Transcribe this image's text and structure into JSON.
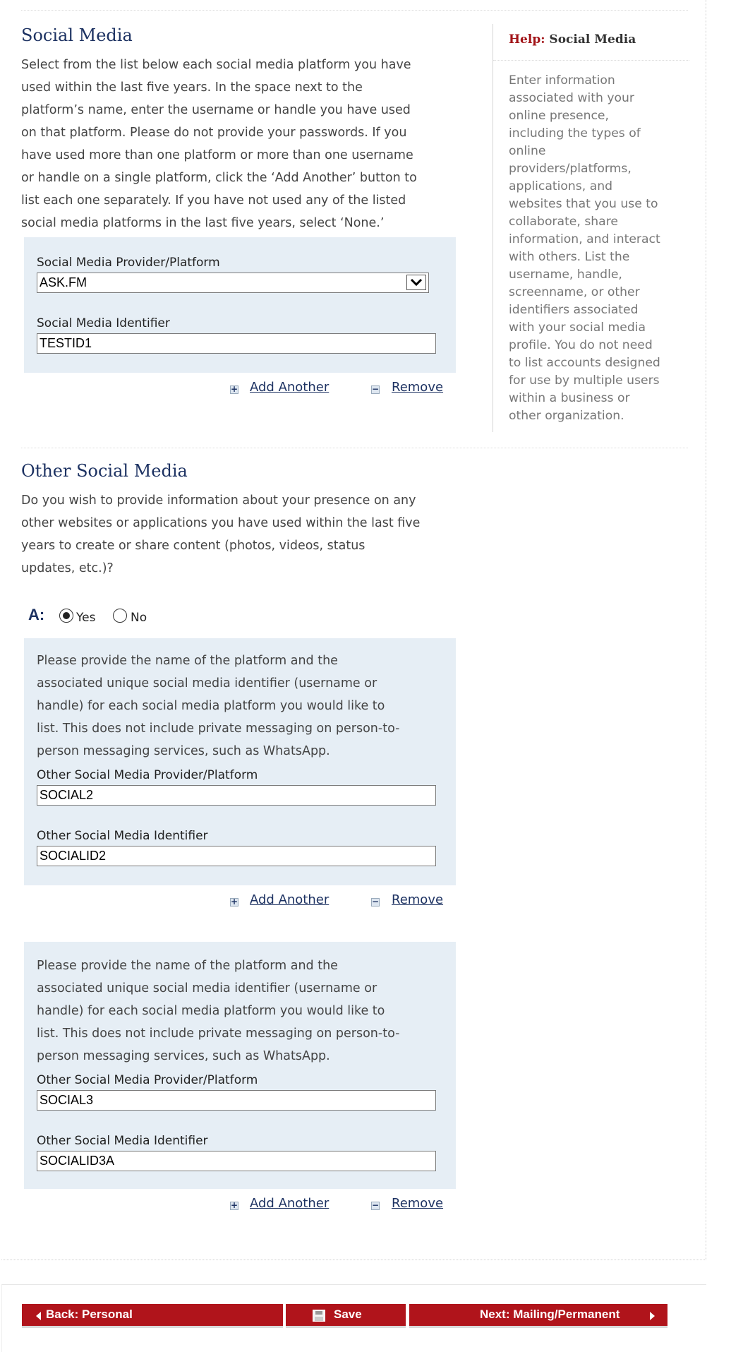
{
  "social_media": {
    "heading": "Social Media",
    "description": [
      "Select from the list below each social media platform you have",
      "used within the last five years. In the space next to the",
      "platform’s name, enter the username or handle you have used",
      "on that platform. Please do not provide your passwords. If you",
      "have used more than one platform or more than one username",
      "or handle on a single platform, click the ‘Add Another’ button to",
      "list each one separately. If you have not used any of the listed",
      "social media platforms in the last five years, select ‘None.’"
    ],
    "entry": {
      "provider_label": "Social Media Provider/Platform",
      "provider_value": "ASK.FM",
      "identifier_label": "Social Media Identifier",
      "identifier_value": "TESTID1"
    },
    "add_another_label": "Add Another",
    "remove_label": "Remove"
  },
  "help": {
    "label": "Help:",
    "topic": "Social Media",
    "text": [
      "Enter information",
      "associated with your",
      "online presence,",
      "including the types of",
      "online",
      "providers/platforms,",
      "applications, and",
      "websites that you use to",
      "collaborate, share",
      "information, and interact",
      "with others. List the",
      "username, handle,",
      "screenname, or other",
      "identifiers associated",
      "with your social media",
      "profile. You do not need",
      "to list accounts designed",
      "for use by multiple users",
      "within a business or",
      "other organization."
    ]
  },
  "other_social_media": {
    "heading": "Other Social Media",
    "question": [
      "Do you wish to provide information about your presence on any",
      "other websites or applications you have used within the last five",
      "years to create or share content (photos, videos, status",
      "updates, etc.)?"
    ],
    "answer_prefix": "A:",
    "yes_label": "Yes",
    "no_label": "No",
    "selected": "Yes",
    "entry_instructions": [
      "Please provide the name of the platform and the",
      "associated unique social media identifier (username or",
      "handle) for each social media platform you would like to",
      "list. This does not include private messaging on person-to-",
      "person messaging services, such as WhatsApp."
    ],
    "provider_label": "Other Social Media Provider/Platform",
    "identifier_label": "Other Social Media Identifier",
    "entries": [
      {
        "provider": "SOCIAL2",
        "identifier": "SOCIALID2"
      },
      {
        "provider": "SOCIAL3",
        "identifier": "SOCIALID3A"
      }
    ],
    "add_another_label": "Add Another",
    "remove_label": "Remove"
  },
  "footer": {
    "back_label": "Back: Personal",
    "save_label": "Save",
    "next_label": "Next: Mailing/Permanent"
  },
  "colors": {
    "heading_blue": "#1d3262",
    "help_red": "#a21418",
    "box_bg": "#e6eef5",
    "button_red": "#b0141b"
  }
}
